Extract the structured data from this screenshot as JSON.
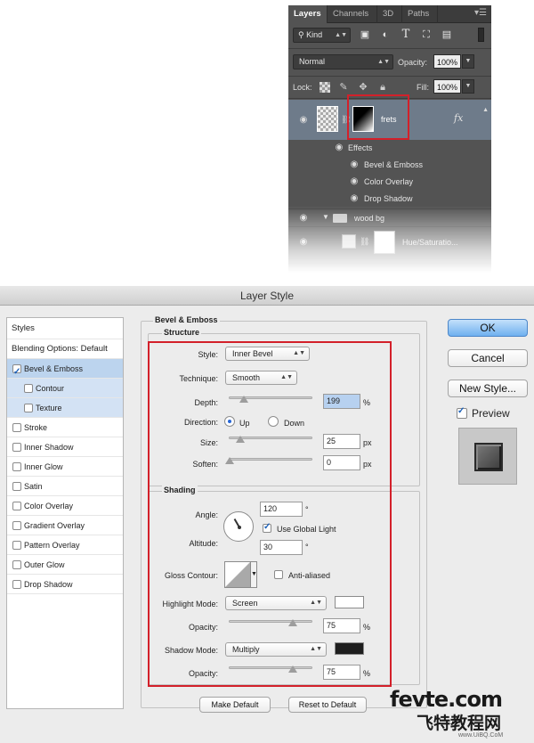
{
  "layers_panel": {
    "tabs": [
      "Layers",
      "Channels",
      "3D",
      "Paths"
    ],
    "filter_kind": "Kind",
    "blend_mode": "Normal",
    "opacity_label": "Opacity:",
    "opacity_value": "100%",
    "lock_label": "Lock:",
    "fill_label": "Fill:",
    "fill_value": "100%",
    "layers": [
      {
        "name": "frets",
        "fx": "fx",
        "effects_label": "Effects",
        "effects": [
          "Bevel & Emboss",
          "Color Overlay",
          "Drop Shadow"
        ]
      },
      {
        "name": "wood bg"
      },
      {
        "name": "Hue/Saturatio..."
      }
    ],
    "icons": [
      "search-icon",
      "image-filter-icon",
      "adjustment-filter-icon",
      "type-filter-icon",
      "shape-filter-icon",
      "smart-object-filter-icon",
      "eye-icon",
      "link-icon",
      "folder-icon",
      "lock-icon",
      "move-icon",
      "brush-icon"
    ],
    "highlight_color": "#d3202a"
  },
  "dialog": {
    "title": "Layer Style",
    "styles_list": {
      "header": "Styles",
      "blending_options": "Blending Options: Default",
      "items": [
        {
          "label": "Bevel & Emboss",
          "checked": true
        },
        {
          "label": "Contour",
          "checked": false
        },
        {
          "label": "Texture",
          "checked": false
        },
        {
          "label": "Stroke",
          "checked": false
        },
        {
          "label": "Inner Shadow",
          "checked": false
        },
        {
          "label": "Inner Glow",
          "checked": false
        },
        {
          "label": "Satin",
          "checked": false
        },
        {
          "label": "Color Overlay",
          "checked": false
        },
        {
          "label": "Gradient Overlay",
          "checked": false
        },
        {
          "label": "Pattern Overlay",
          "checked": false
        },
        {
          "label": "Outer Glow",
          "checked": false
        },
        {
          "label": "Drop Shadow",
          "checked": false
        }
      ]
    },
    "bevel": {
      "section_title": "Bevel & Emboss",
      "structure_title": "Structure",
      "style_label": "Style:",
      "style_value": "Inner Bevel",
      "technique_label": "Technique:",
      "technique_value": "Smooth",
      "depth_label": "Depth:",
      "depth_value": "199",
      "depth_unit": "%",
      "direction_label": "Direction:",
      "direction_up": "Up",
      "direction_down": "Down",
      "size_label": "Size:",
      "size_value": "25",
      "size_unit": "px",
      "soften_label": "Soften:",
      "soften_value": "0",
      "soften_unit": "px",
      "shading_title": "Shading",
      "angle_label": "Angle:",
      "angle_value": "120",
      "angle_unit": "°",
      "global_light_label": "Use Global Light",
      "altitude_label": "Altitude:",
      "altitude_value": "30",
      "altitude_unit": "°",
      "gloss_label": "Gloss Contour:",
      "anti_aliased_label": "Anti-aliased",
      "highlight_mode_label": "Highlight Mode:",
      "highlight_mode_value": "Screen",
      "highlight_color": "#ffffff",
      "opacity_label": "Opacity:",
      "highlight_opacity": "75",
      "opacity_unit": "%",
      "shadow_mode_label": "Shadow Mode:",
      "shadow_mode_value": "Multiply",
      "shadow_color": "#1e1e1e",
      "shadow_opacity": "75",
      "make_default": "Make Default",
      "reset_default": "Reset to Default"
    },
    "buttons": {
      "ok": "OK",
      "cancel": "Cancel",
      "new_style": "New Style...",
      "preview": "Preview"
    }
  },
  "watermark": {
    "line1": "fevte.com",
    "line2": "飞特教程网",
    "line3": "www.UiBQ.CoM"
  }
}
